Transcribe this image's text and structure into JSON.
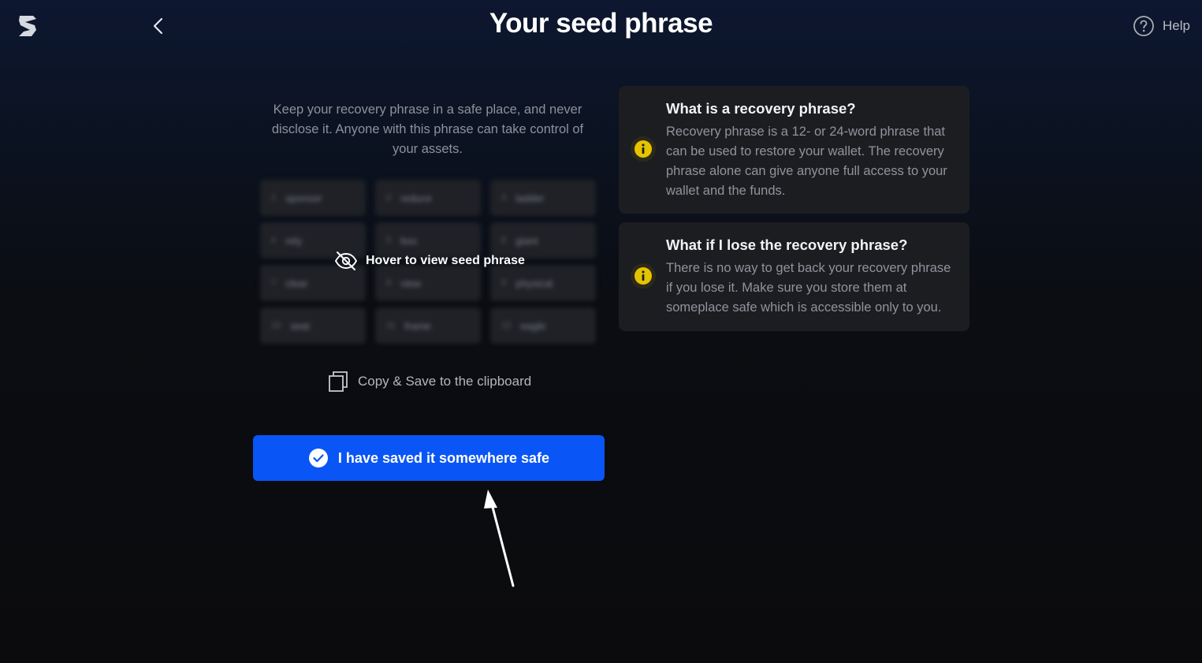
{
  "header": {
    "title": "Your seed phrase",
    "help_label": "Help",
    "logo_icon": "brand-s-logo",
    "back_icon": "chevron-left-icon"
  },
  "intro": {
    "text": "Keep your recovery phrase in a safe place, and never disclose it. Anyone with this phrase can take control of your assets."
  },
  "seed_grid": {
    "blurred": true,
    "words": [
      {
        "n": "1",
        "w": "sponsor"
      },
      {
        "n": "2",
        "w": "reduce"
      },
      {
        "n": "3",
        "w": "ladder"
      },
      {
        "n": "4",
        "w": "rely"
      },
      {
        "n": "5",
        "w": "box"
      },
      {
        "n": "6",
        "w": "giant"
      },
      {
        "n": "7",
        "w": "clear"
      },
      {
        "n": "8",
        "w": "view"
      },
      {
        "n": "9",
        "w": "physical"
      },
      {
        "n": "10",
        "w": "seat"
      },
      {
        "n": "11",
        "w": "frame"
      },
      {
        "n": "12",
        "w": "eagle"
      }
    ],
    "hover_hint": "Hover to view seed phrase"
  },
  "copy": {
    "label": "Copy & Save to the clipboard"
  },
  "confirm": {
    "label": "I have saved it somewhere safe"
  },
  "info_cards": [
    {
      "title": "What is a recovery phrase?",
      "body": "Recovery phrase is a 12- or 24-word phrase that can be used to restore your wallet. The recovery phrase alone can give anyone full access to your wallet and the funds."
    },
    {
      "title": "What if I lose the recovery phrase?",
      "body": "There is no way to get back your recovery phrase if you lose it. Make sure you store them at someplace safe which is accessible only to you."
    }
  ],
  "colors": {
    "accent": "#0a55f5",
    "info": "#e5c300"
  }
}
